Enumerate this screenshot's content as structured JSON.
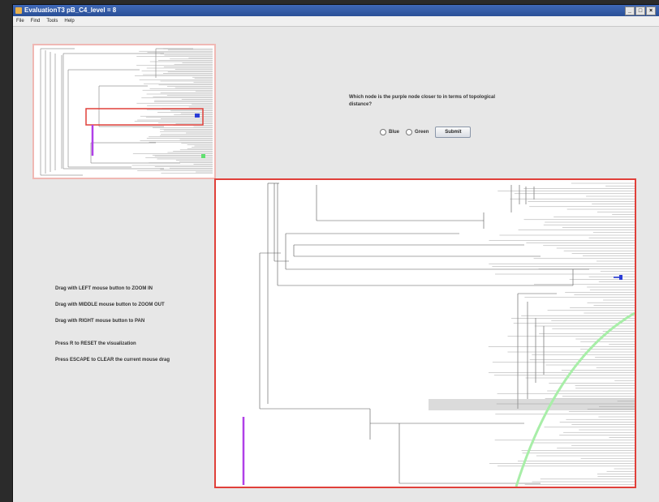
{
  "window": {
    "title": "EvaluationT3 pB_C4_level = 8",
    "controls": [
      "_",
      "□",
      "×"
    ]
  },
  "menu": [
    "File",
    "Find",
    "Tools",
    "Help"
  ],
  "question": {
    "text": "Which node is the purple node closer to in terms of topological distance?",
    "options": [
      "Blue",
      "Green"
    ],
    "submit_label": "Submit"
  },
  "instructions": [
    "Drag with LEFT mouse button to ZOOM IN",
    "Drag with MIDDLE mouse button to ZOOM OUT",
    "Drag with RIGHT mouse button to PAN",
    "Press R to RESET the visualization",
    "Press ESCAPE to CLEAR the current mouse drag"
  ],
  "colors": {
    "selection_box": "#e0403a",
    "overview_border": "#f0b8b4",
    "purple_node": "#b040e8",
    "blue_node": "#2a3cd6",
    "green_node": "#60e070",
    "green_path": "#a8eea8"
  }
}
